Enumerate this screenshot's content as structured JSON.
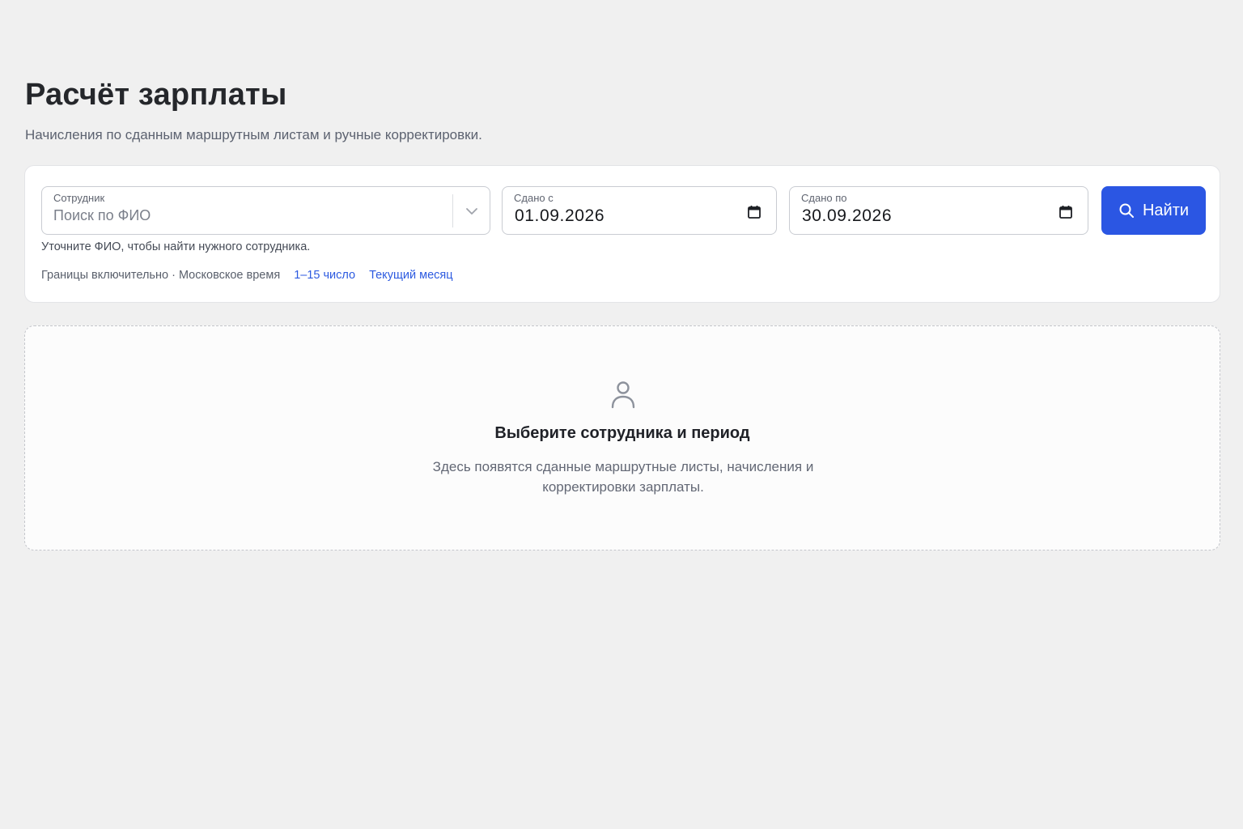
{
  "header": {
    "title": "Расчёт зарплаты",
    "subtitle": "Начисления по сданным маршрутным листам и ручные корректировки."
  },
  "filters": {
    "employee": {
      "label": "Сотрудник",
      "placeholder": "Поиск по ФИО",
      "value": "",
      "hint": "Уточните ФИО, чтобы найти нужного сотрудника."
    },
    "date_from": {
      "label": "Сдано с",
      "value": "01.09.2026"
    },
    "date_to": {
      "label": "Сдано по",
      "value": "30.09.2026"
    },
    "search_button": "Найти",
    "bounds_note": "Границы включительно · Московское время",
    "quick_ranges": [
      "1–15 число",
      "Текущий месяц"
    ]
  },
  "empty_state": {
    "icon": "user-icon",
    "title": "Выберите сотрудника и период",
    "text": "Здесь появятся сданные маршрутные листы, начисления и корректировки зарплаты."
  },
  "colors": {
    "background": "#f0f0f0",
    "accent": "#2b56e3",
    "link": "#2c5ae0",
    "card": "#ffffff"
  }
}
